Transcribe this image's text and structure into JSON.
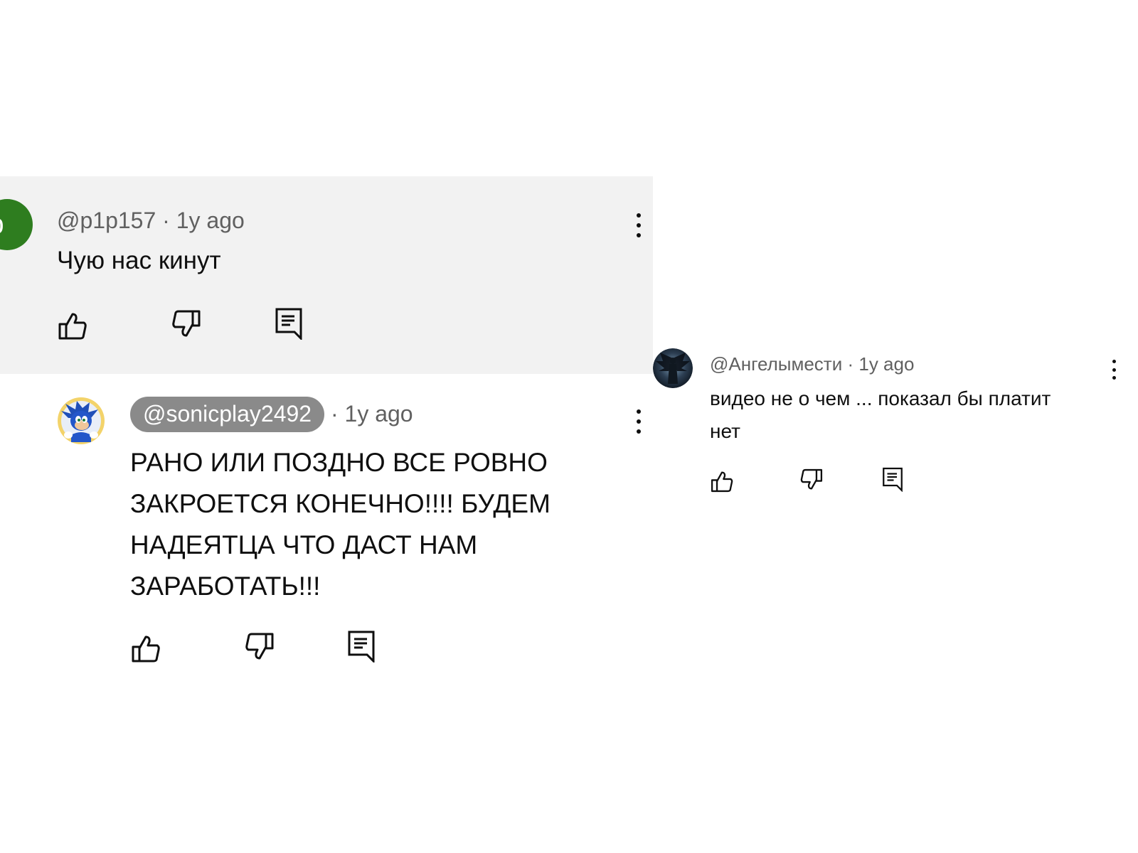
{
  "comments": [
    {
      "avatar_letter": "p",
      "avatar_color": "#2e7d1f",
      "handle": "@p1p157",
      "separator": "·",
      "time": "1y ago",
      "text": "Чую нас кинут",
      "highlighted": true,
      "icons": [
        "like-icon",
        "dislike-icon",
        "reply-icon",
        "more-vert-icon"
      ]
    },
    {
      "avatar_icon": "sonic-avatar",
      "handle": "@sonicplay2492",
      "handle_chip_color": "#8a8a8a",
      "separator": "·",
      "time": "1y ago",
      "text_lines": [
        "РАНО ИЛИ ПОЗДНО ВСЕ РОВНО",
        "ЗАКРОЕТСЯ КОНЕЧНО!!!! БУДЕМ",
        "НАДЕЯТЦА ЧТО ДАСТ НАМ",
        "ЗАРАБОТАТЬ!!!"
      ],
      "icons": [
        "like-icon",
        "dislike-icon",
        "reply-icon",
        "more-vert-icon"
      ]
    },
    {
      "avatar_icon": "dark-angel-avatar",
      "handle": "@Ангелымести",
      "separator": "·",
      "time": "1y ago",
      "text_lines": [
        "видео не о чем ... показал бы платит",
        "нет"
      ],
      "icons": [
        "like-icon",
        "dislike-icon",
        "reply-icon",
        "more-vert-icon"
      ]
    }
  ],
  "colors": {
    "highlight_background": "#f2f2f2",
    "meta_text": "#606060",
    "body_text": "#0f0f0f"
  }
}
